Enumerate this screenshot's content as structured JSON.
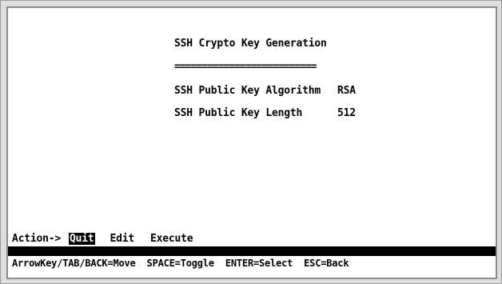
{
  "screen": {
    "title": "SSH Crypto Key Generation",
    "divider": "==========================",
    "fields": [
      {
        "label": "SSH Public Key Algorithm",
        "value": "RSA"
      },
      {
        "label": "SSH Public Key Length",
        "value": "512"
      }
    ]
  },
  "action_bar": {
    "label": "Action->",
    "items": [
      "Quit",
      "Edit",
      "Execute"
    ],
    "selected": "Quit"
  },
  "help_line": {
    "items": [
      "ArrowKey/TAB/BACK=Move",
      "SPACE=Toggle",
      "ENTER=Select",
      "ESC=Back"
    ]
  },
  "colors": {
    "screen_bg": "#ffffff",
    "text": "#000000",
    "highlight_bg": "#000000",
    "highlight_text": "#ffffff"
  }
}
